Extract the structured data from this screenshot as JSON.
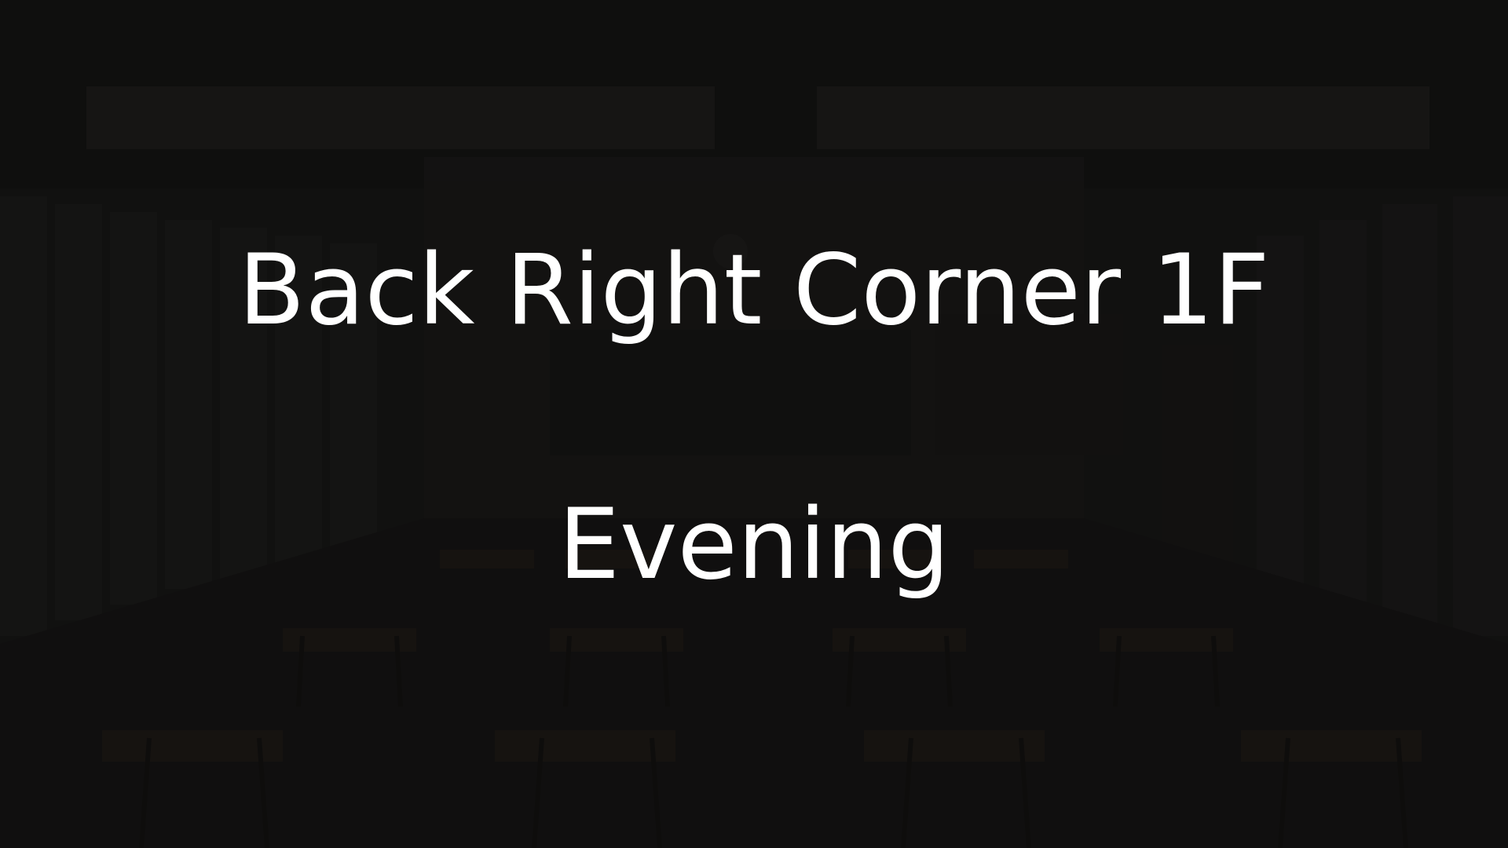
{
  "scene": {
    "background": "dark-classroom-icon",
    "location": "Back Right Corner 1F",
    "time_of_day": "Evening"
  },
  "colors": {
    "text": "#ffffff",
    "overlay": "#080808",
    "background": "#111111"
  }
}
